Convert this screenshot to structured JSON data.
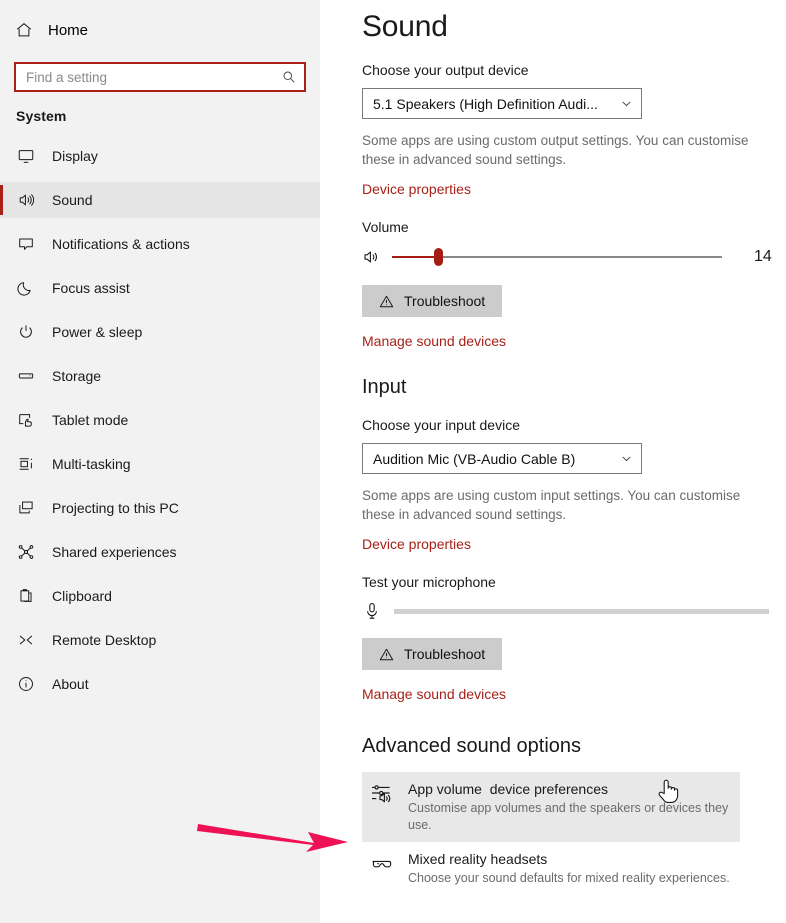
{
  "colors": {
    "accent_red": "#a82018",
    "slider_red": "#a51d12",
    "annotation_pink": "#ee1155",
    "sidebar_bg": "#f2f2f2",
    "button_bg": "#cccccc",
    "highlight_row_bg": "#e8e8e8"
  },
  "sidebar": {
    "home_label": "Home",
    "search": {
      "placeholder": "Find a setting",
      "value": "",
      "icon": "search-icon"
    },
    "group_title": "System",
    "items": [
      {
        "label": "Display",
        "icon": "monitor-icon",
        "selected": false
      },
      {
        "label": "Sound",
        "icon": "speaker-icon",
        "selected": true
      },
      {
        "label": "Notifications & actions",
        "icon": "chat-bubble-icon",
        "selected": false
      },
      {
        "label": "Focus assist",
        "icon": "moon-icon",
        "selected": false
      },
      {
        "label": "Power & sleep",
        "icon": "power-icon",
        "selected": false
      },
      {
        "label": "Storage",
        "icon": "drive-icon",
        "selected": false
      },
      {
        "label": "Tablet mode",
        "icon": "tablet-hand-icon",
        "selected": false
      },
      {
        "label": "Multi-tasking",
        "icon": "multitask-icon",
        "selected": false
      },
      {
        "label": "Projecting to this PC",
        "icon": "project-screen-icon",
        "selected": false
      },
      {
        "label": "Shared experiences",
        "icon": "share-nodes-icon",
        "selected": false
      },
      {
        "label": "Clipboard",
        "icon": "clipboard-icon",
        "selected": false
      },
      {
        "label": "Remote Desktop",
        "icon": "remote-desktop-icon",
        "selected": false
      },
      {
        "label": "About",
        "icon": "info-icon",
        "selected": false
      }
    ]
  },
  "main": {
    "page_title": "Sound",
    "output": {
      "device_label": "Choose your output device",
      "device_value": "5.1 Speakers (High Definition Audi...",
      "helper_text": "Some apps are using custom output settings. You can customise these in advanced sound settings.",
      "device_properties_link": "Device properties",
      "volume_label": "Volume",
      "volume_value": "14",
      "volume_percent": 14,
      "troubleshoot_label": "Troubleshoot",
      "manage_link": "Manage sound devices"
    },
    "input": {
      "section_title": "Input",
      "device_label": "Choose your input device",
      "device_value": "Audition Mic (VB-Audio Cable B)",
      "helper_text": "Some apps are using custom input settings. You can customise these in advanced sound settings.",
      "device_properties_link": "Device properties",
      "test_label": "Test your microphone",
      "test_level_percent": 0,
      "troubleshoot_label": "Troubleshoot",
      "manage_link": "Manage sound devices"
    },
    "advanced": {
      "section_title": "Advanced sound options",
      "rows": [
        {
          "title": "App volume  device preferences",
          "subtitle": "Customise app volumes and the speakers or devices they use.",
          "icon": "app-volume-mixer-icon",
          "highlighted": true
        },
        {
          "title": "Mixed reality headsets",
          "subtitle": "Choose your sound defaults for mixed reality experiences.",
          "icon": "vr-headset-icon",
          "highlighted": false
        }
      ]
    }
  },
  "annotations": {
    "arrow": {
      "name": "pointer-arrow-annotation",
      "points_to": "App volume  device preferences"
    },
    "cursor": {
      "name": "hand-cursor"
    }
  }
}
